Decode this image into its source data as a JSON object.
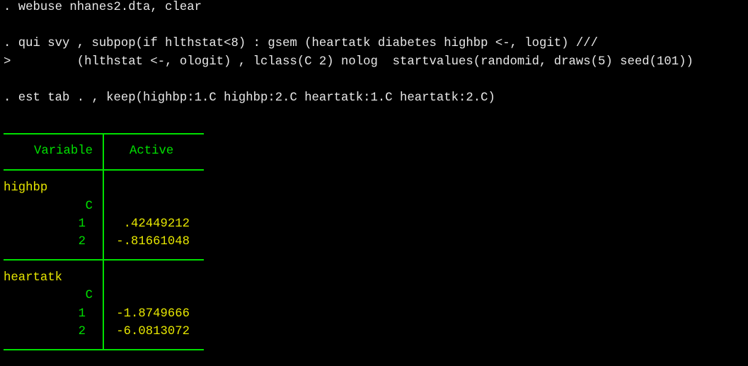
{
  "commands": [
    ". webuse nhanes2.dta, clear",
    ". qui svy , subpop(if hlthstat<8) : gsem (heartatk diabetes highbp <-, logit) ///",
    ">         (hlthstat <-, ologit) , lclass(C 2) nolog  startvalues(randomid, draws(5) seed(101))",
    ". est tab . , keep(highbp:1.C highbp:2.C heartatk:1.C heartatk:2.C)"
  ],
  "table": {
    "headers": [
      "Variable",
      "Active"
    ],
    "groups": [
      {
        "name": "highbp",
        "factor": "C",
        "rows": [
          {
            "level": "1",
            "value": ".42449212"
          },
          {
            "level": "2",
            "value": "-.81661048"
          }
        ]
      },
      {
        "name": "heartatk",
        "factor": "C",
        "rows": [
          {
            "level": "1",
            "value": "-1.8749666"
          },
          {
            "level": "2",
            "value": "-6.0813072"
          }
        ]
      }
    ]
  },
  "colors": {
    "background": "#000000",
    "command": "#e8e8e8",
    "table": "#00e000",
    "result": "#e6e600"
  }
}
